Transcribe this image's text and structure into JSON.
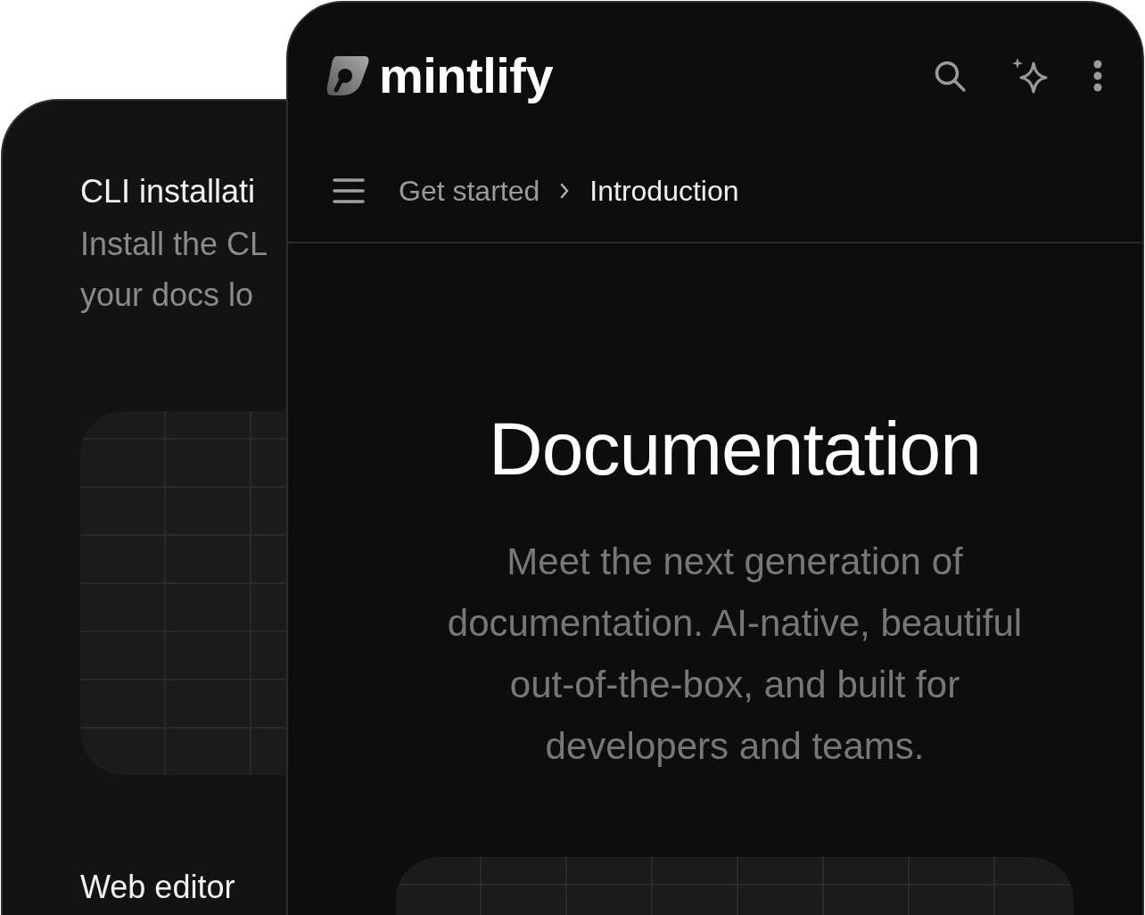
{
  "back_screen": {
    "section_title": "CLI installati",
    "description_lines": [
      "Install the CL",
      "your docs lo"
    ],
    "next_section_title": "Web editor"
  },
  "front_screen": {
    "logo_text": "mintlify",
    "breadcrumb": [
      {
        "label": "Get started",
        "selected": false
      },
      {
        "label": "Introduction",
        "selected": true
      }
    ],
    "hero_title": "Documentation",
    "hero_description": "Meet the next generation of documentation. AI-native, beautiful out-of-the-box, and built for developers and teams."
  }
}
